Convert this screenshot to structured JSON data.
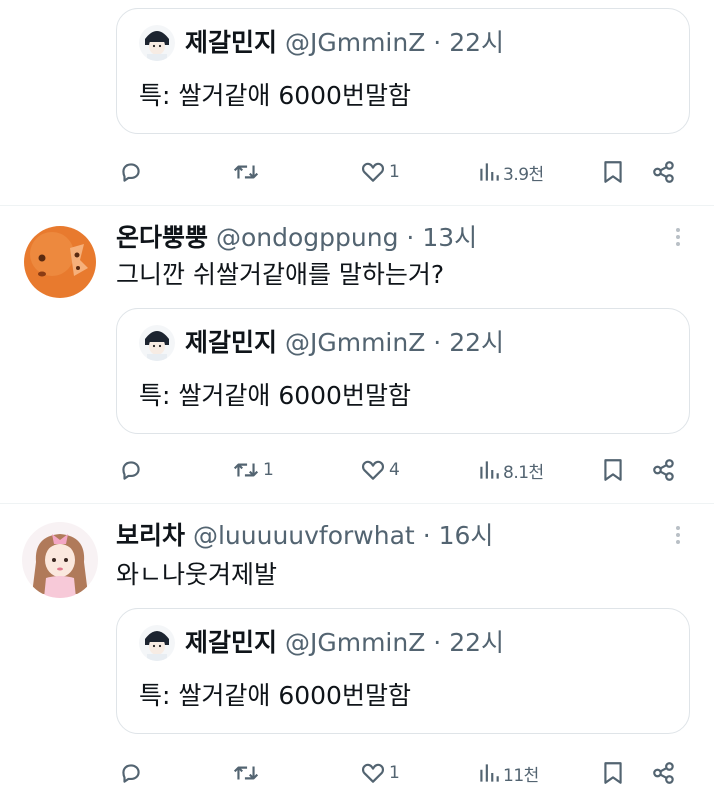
{
  "colors": {
    "text": "#0f1419",
    "muted": "#536471",
    "border": "#dfe4e8",
    "divider": "#eff3f4"
  },
  "quoted": {
    "name": "제갈민지",
    "handle": "@JGmminZ",
    "separator": "·",
    "time": "22시",
    "text": "특: 쌀거같애 6000번말함"
  },
  "top_actions": {
    "reply": "",
    "retweet": "",
    "like": "1",
    "views": "3.9천"
  },
  "posts": [
    {
      "name": "온다뿡뿡",
      "handle": "@ondogppung",
      "separator": "·",
      "time": "13시",
      "text": "그니깐 쉬쌀거같애를 말하는거?",
      "avatar_icon": "orange-character-avatar",
      "actions": {
        "reply": "",
        "retweet": "1",
        "like": "4",
        "views": "8.1천"
      }
    },
    {
      "name": "보리차",
      "handle": "@luuuuuvforwhat",
      "separator": "·",
      "time": "16시",
      "text": "와ㄴ나웃겨제발",
      "avatar_icon": "doll-avatar",
      "actions": {
        "reply": "",
        "retweet": "",
        "like": "1",
        "views": "11천"
      }
    }
  ]
}
